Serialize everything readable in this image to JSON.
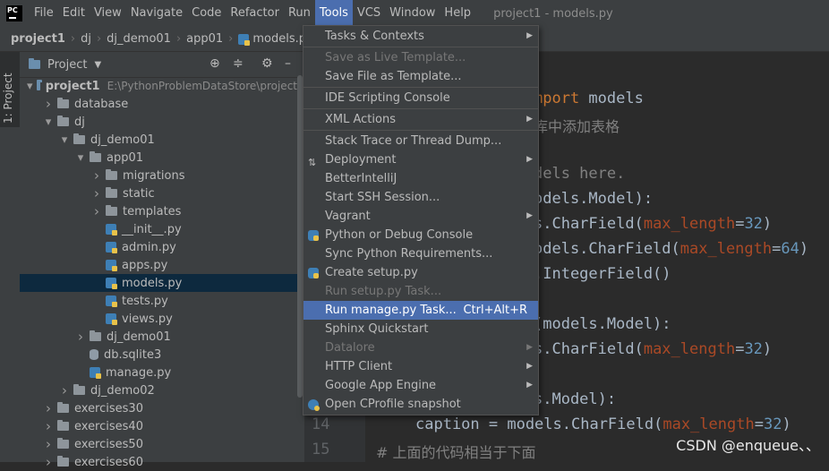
{
  "menubar": {
    "items": [
      "File",
      "Edit",
      "View",
      "Navigate",
      "Code",
      "Refactor",
      "Run",
      "Tools",
      "VCS",
      "Window",
      "Help"
    ],
    "active_index": 7,
    "window_title": "project1 - models.py"
  },
  "breadcrumb": [
    "project1",
    "dj",
    "dj_demo01",
    "app01",
    "models.py"
  ],
  "left_strip": {
    "label": "1: Project"
  },
  "project_panel": {
    "title": "Project",
    "tree": [
      {
        "depth": 0,
        "arrow": "open",
        "icon": "folder-blue",
        "name": "project1",
        "path": "E:\\PythonProblemDataStore\\project",
        "bold": true
      },
      {
        "depth": 1,
        "arrow": "closed",
        "icon": "folder",
        "name": "database"
      },
      {
        "depth": 1,
        "arrow": "open",
        "icon": "folder",
        "name": "dj"
      },
      {
        "depth": 2,
        "arrow": "open",
        "icon": "folder",
        "name": "dj_demo01"
      },
      {
        "depth": 3,
        "arrow": "open",
        "icon": "folder",
        "name": "app01"
      },
      {
        "depth": 4,
        "arrow": "closed",
        "icon": "folder",
        "name": "migrations"
      },
      {
        "depth": 4,
        "arrow": "closed",
        "icon": "folder",
        "name": "static"
      },
      {
        "depth": 4,
        "arrow": "closed",
        "icon": "folder",
        "name": "templates"
      },
      {
        "depth": 4,
        "arrow": "none",
        "icon": "py",
        "name": "__init__.py"
      },
      {
        "depth": 4,
        "arrow": "none",
        "icon": "py",
        "name": "admin.py"
      },
      {
        "depth": 4,
        "arrow": "none",
        "icon": "py",
        "name": "apps.py"
      },
      {
        "depth": 4,
        "arrow": "none",
        "icon": "py",
        "name": "models.py",
        "selected": true
      },
      {
        "depth": 4,
        "arrow": "none",
        "icon": "py",
        "name": "tests.py"
      },
      {
        "depth": 4,
        "arrow": "none",
        "icon": "py",
        "name": "views.py"
      },
      {
        "depth": 3,
        "arrow": "closed",
        "icon": "folder",
        "name": "dj_demo01"
      },
      {
        "depth": 3,
        "arrow": "none",
        "icon": "db",
        "name": "db.sqlite3"
      },
      {
        "depth": 3,
        "arrow": "none",
        "icon": "py",
        "name": "manage.py"
      },
      {
        "depth": 2,
        "arrow": "closed",
        "icon": "folder",
        "name": "dj_demo02"
      },
      {
        "depth": 1,
        "arrow": "closed",
        "icon": "folder",
        "name": "exercises30"
      },
      {
        "depth": 1,
        "arrow": "closed",
        "icon": "folder",
        "name": "exercises40"
      },
      {
        "depth": 1,
        "arrow": "closed",
        "icon": "folder",
        "name": "exercises50"
      },
      {
        "depth": 1,
        "arrow": "closed",
        "icon": "folder",
        "name": "exercises60"
      }
    ]
  },
  "editor": {
    "line_numbers": [
      "14",
      "15"
    ],
    "lines": [
      {
        "parts": [
          {
            "t": "mport ",
            "c": "kw"
          },
          {
            "t": "models",
            "c": "tx"
          }
        ]
      },
      {
        "parts": [
          {
            "t": "库中添加表格",
            "c": "cm"
          }
        ]
      },
      {
        "parts": [
          {
            "t": "dels here.",
            "c": "cm"
          }
        ]
      },
      {
        "parts": [
          {
            "t": "odels.Model):",
            "c": "tx"
          }
        ]
      },
      {
        "parts": [
          {
            "t": "s.CharField(",
            "c": "tx"
          },
          {
            "t": "max_length",
            "c": "pm"
          },
          {
            "t": "=",
            "c": "tx"
          },
          {
            "t": "32",
            "c": "nm"
          },
          {
            "t": ")",
            "c": "tx"
          }
        ]
      },
      {
        "parts": [
          {
            "t": "odels.CharField(",
            "c": "tx"
          },
          {
            "t": "max_length",
            "c": "pm"
          },
          {
            "t": "=",
            "c": "tx"
          },
          {
            "t": "64",
            "c": "nm"
          },
          {
            "t": ")",
            "c": "tx"
          }
        ]
      },
      {
        "parts": [
          {
            "t": ".IntegerField()",
            "c": "tx"
          }
        ]
      },
      {
        "parts": [
          {
            "t": "(models.Model):",
            "c": "tx"
          }
        ]
      },
      {
        "parts": [
          {
            "t": "s.CharField(",
            "c": "tx"
          },
          {
            "t": "max_length",
            "c": "pm"
          },
          {
            "t": "=",
            "c": "tx"
          },
          {
            "t": "32",
            "c": "nm"
          },
          {
            "t": ")",
            "c": "tx"
          }
        ]
      },
      {
        "parts": [
          {
            "t": "s.Model):",
            "c": "tx"
          }
        ]
      },
      {
        "parts": [
          {
            "t": "caption = models.CharField(",
            "c": "tx"
          },
          {
            "t": "max_length",
            "c": "pm"
          },
          {
            "t": "=",
            "c": "tx"
          },
          {
            "t": "32",
            "c": "nm"
          },
          {
            "t": ")",
            "c": "tx"
          }
        ]
      },
      {
        "parts": [
          {
            "t": "# 上面的代码相当于下面",
            "c": "cm"
          }
        ]
      }
    ]
  },
  "tools_menu": [
    {
      "label": "Tasks & Contexts",
      "submenu": true
    },
    {
      "sep": true
    },
    {
      "label": "Save as Live Template...",
      "disabled": true
    },
    {
      "label": "Save File as Template..."
    },
    {
      "sep": true
    },
    {
      "label": "IDE Scripting Console"
    },
    {
      "sep": true
    },
    {
      "label": "XML Actions",
      "submenu": true
    },
    {
      "sep": true
    },
    {
      "label": "Stack Trace or Thread Dump..."
    },
    {
      "label": "Deployment",
      "submenu": true,
      "icon": "deploy-icon"
    },
    {
      "label": "BetterIntelliJ"
    },
    {
      "label": "Start SSH Session..."
    },
    {
      "label": "Vagrant",
      "submenu": true
    },
    {
      "label": "Python or Debug Console",
      "icon": "python-icon"
    },
    {
      "label": "Sync Python Requirements..."
    },
    {
      "label": "Create setup.py",
      "icon": "python-icon"
    },
    {
      "label": "Run setup.py Task...",
      "disabled": true
    },
    {
      "label": "Run manage.py Task...",
      "shortcut": "Ctrl+Alt+R",
      "highlighted": true
    },
    {
      "label": "Sphinx Quickstart"
    },
    {
      "label": "Datalore",
      "submenu": true,
      "disabled": true
    },
    {
      "label": "HTTP Client",
      "submenu": true
    },
    {
      "label": "Google App Engine",
      "submenu": true
    },
    {
      "label": "Open CProfile snapshot",
      "icon": "profile-icon"
    }
  ],
  "watermark": "CSDN @enqueue、、",
  "colors": {
    "menu_bg": "#3c3f41",
    "highlight": "#4b6eaf",
    "editor_bg": "#2b2b2b",
    "selected_row": "#0d293e"
  }
}
